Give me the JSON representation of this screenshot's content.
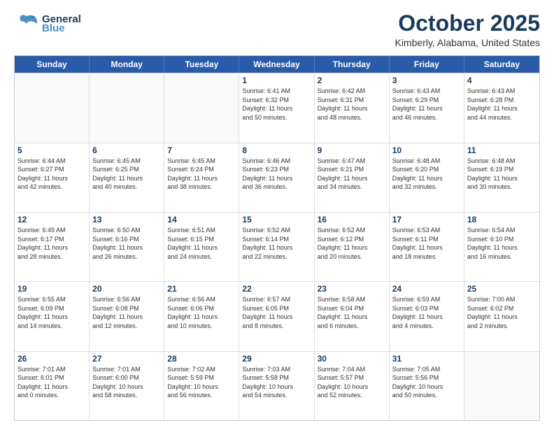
{
  "header": {
    "logo_general": "General",
    "logo_blue": "Blue",
    "month": "October 2025",
    "location": "Kimberly, Alabama, United States"
  },
  "weekdays": [
    "Sunday",
    "Monday",
    "Tuesday",
    "Wednesday",
    "Thursday",
    "Friday",
    "Saturday"
  ],
  "weeks": [
    [
      {
        "day": "",
        "text": ""
      },
      {
        "day": "",
        "text": ""
      },
      {
        "day": "",
        "text": ""
      },
      {
        "day": "1",
        "text": "Sunrise: 6:41 AM\nSunset: 6:32 PM\nDaylight: 11 hours\nand 50 minutes."
      },
      {
        "day": "2",
        "text": "Sunrise: 6:42 AM\nSunset: 6:31 PM\nDaylight: 11 hours\nand 48 minutes."
      },
      {
        "day": "3",
        "text": "Sunrise: 6:43 AM\nSunset: 6:29 PM\nDaylight: 11 hours\nand 46 minutes."
      },
      {
        "day": "4",
        "text": "Sunrise: 6:43 AM\nSunset: 6:28 PM\nDaylight: 11 hours\nand 44 minutes."
      }
    ],
    [
      {
        "day": "5",
        "text": "Sunrise: 6:44 AM\nSunset: 6:27 PM\nDaylight: 11 hours\nand 42 minutes."
      },
      {
        "day": "6",
        "text": "Sunrise: 6:45 AM\nSunset: 6:25 PM\nDaylight: 11 hours\nand 40 minutes."
      },
      {
        "day": "7",
        "text": "Sunrise: 6:45 AM\nSunset: 6:24 PM\nDaylight: 11 hours\nand 38 minutes."
      },
      {
        "day": "8",
        "text": "Sunrise: 6:46 AM\nSunset: 6:23 PM\nDaylight: 11 hours\nand 36 minutes."
      },
      {
        "day": "9",
        "text": "Sunrise: 6:47 AM\nSunset: 6:21 PM\nDaylight: 11 hours\nand 34 minutes."
      },
      {
        "day": "10",
        "text": "Sunrise: 6:48 AM\nSunset: 6:20 PM\nDaylight: 11 hours\nand 32 minutes."
      },
      {
        "day": "11",
        "text": "Sunrise: 6:48 AM\nSunset: 6:19 PM\nDaylight: 11 hours\nand 30 minutes."
      }
    ],
    [
      {
        "day": "12",
        "text": "Sunrise: 6:49 AM\nSunset: 6:17 PM\nDaylight: 11 hours\nand 28 minutes."
      },
      {
        "day": "13",
        "text": "Sunrise: 6:50 AM\nSunset: 6:16 PM\nDaylight: 11 hours\nand 26 minutes."
      },
      {
        "day": "14",
        "text": "Sunrise: 6:51 AM\nSunset: 6:15 PM\nDaylight: 11 hours\nand 24 minutes."
      },
      {
        "day": "15",
        "text": "Sunrise: 6:52 AM\nSunset: 6:14 PM\nDaylight: 11 hours\nand 22 minutes."
      },
      {
        "day": "16",
        "text": "Sunrise: 6:52 AM\nSunset: 6:12 PM\nDaylight: 11 hours\nand 20 minutes."
      },
      {
        "day": "17",
        "text": "Sunrise: 6:53 AM\nSunset: 6:11 PM\nDaylight: 11 hours\nand 18 minutes."
      },
      {
        "day": "18",
        "text": "Sunrise: 6:54 AM\nSunset: 6:10 PM\nDaylight: 11 hours\nand 16 minutes."
      }
    ],
    [
      {
        "day": "19",
        "text": "Sunrise: 6:55 AM\nSunset: 6:09 PM\nDaylight: 11 hours\nand 14 minutes."
      },
      {
        "day": "20",
        "text": "Sunrise: 6:56 AM\nSunset: 6:08 PM\nDaylight: 11 hours\nand 12 minutes."
      },
      {
        "day": "21",
        "text": "Sunrise: 6:56 AM\nSunset: 6:06 PM\nDaylight: 11 hours\nand 10 minutes."
      },
      {
        "day": "22",
        "text": "Sunrise: 6:57 AM\nSunset: 6:05 PM\nDaylight: 11 hours\nand 8 minutes."
      },
      {
        "day": "23",
        "text": "Sunrise: 6:58 AM\nSunset: 6:04 PM\nDaylight: 11 hours\nand 6 minutes."
      },
      {
        "day": "24",
        "text": "Sunrise: 6:59 AM\nSunset: 6:03 PM\nDaylight: 11 hours\nand 4 minutes."
      },
      {
        "day": "25",
        "text": "Sunrise: 7:00 AM\nSunset: 6:02 PM\nDaylight: 11 hours\nand 2 minutes."
      }
    ],
    [
      {
        "day": "26",
        "text": "Sunrise: 7:01 AM\nSunset: 6:01 PM\nDaylight: 11 hours\nand 0 minutes."
      },
      {
        "day": "27",
        "text": "Sunrise: 7:01 AM\nSunset: 6:00 PM\nDaylight: 10 hours\nand 58 minutes."
      },
      {
        "day": "28",
        "text": "Sunrise: 7:02 AM\nSunset: 5:59 PM\nDaylight: 10 hours\nand 56 minutes."
      },
      {
        "day": "29",
        "text": "Sunrise: 7:03 AM\nSunset: 5:58 PM\nDaylight: 10 hours\nand 54 minutes."
      },
      {
        "day": "30",
        "text": "Sunrise: 7:04 AM\nSunset: 5:57 PM\nDaylight: 10 hours\nand 52 minutes."
      },
      {
        "day": "31",
        "text": "Sunrise: 7:05 AM\nSunset: 5:56 PM\nDaylight: 10 hours\nand 50 minutes."
      },
      {
        "day": "",
        "text": ""
      }
    ]
  ]
}
